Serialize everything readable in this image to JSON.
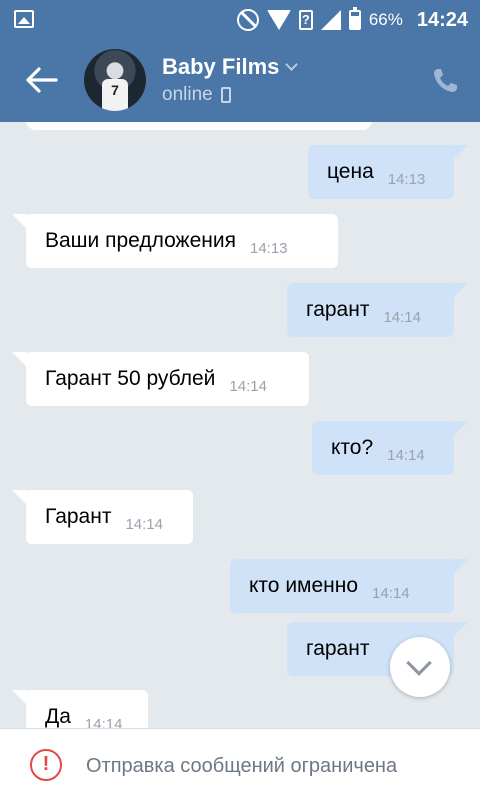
{
  "status_bar": {
    "battery": "66%",
    "time": "14:24",
    "icons": [
      "gallery-icon",
      "do-not-disturb-icon",
      "wifi-icon",
      "question-icon",
      "signal-icon",
      "battery-icon"
    ]
  },
  "header": {
    "name": "Baby Films",
    "status": "online",
    "avatar_jersey": "7",
    "icons": [
      "back-arrow-icon",
      "chevron-down-icon",
      "mobile-device-icon",
      "phone-icon"
    ]
  },
  "messages": [
    {
      "dir": "out",
      "text": "цена",
      "time": "14:13"
    },
    {
      "dir": "in",
      "text": "Ваши предложения",
      "time": "14:13"
    },
    {
      "dir": "out",
      "text": "гарант",
      "time": "14:14"
    },
    {
      "dir": "in",
      "text": "Гарант 50 рублей",
      "time": "14:14"
    },
    {
      "dir": "out",
      "text": "кто?",
      "time": "14:14"
    },
    {
      "dir": "in",
      "text": "Гарант",
      "time": "14:14"
    },
    {
      "dir": "out",
      "text": "кто именно",
      "time": "14:14"
    },
    {
      "dir": "out",
      "text": "гарант",
      "time": ""
    },
    {
      "dir": "in",
      "text": "Да",
      "time": "14:14"
    }
  ],
  "footer": {
    "notice": "Отправка сообщений ограничена"
  },
  "colors": {
    "header_bg": "#4a76a8",
    "chat_bg": "#e4e9ee",
    "outgoing_bubble": "#cfe2f8",
    "incoming_bubble": "#ffffff",
    "warning": "#e64646"
  }
}
